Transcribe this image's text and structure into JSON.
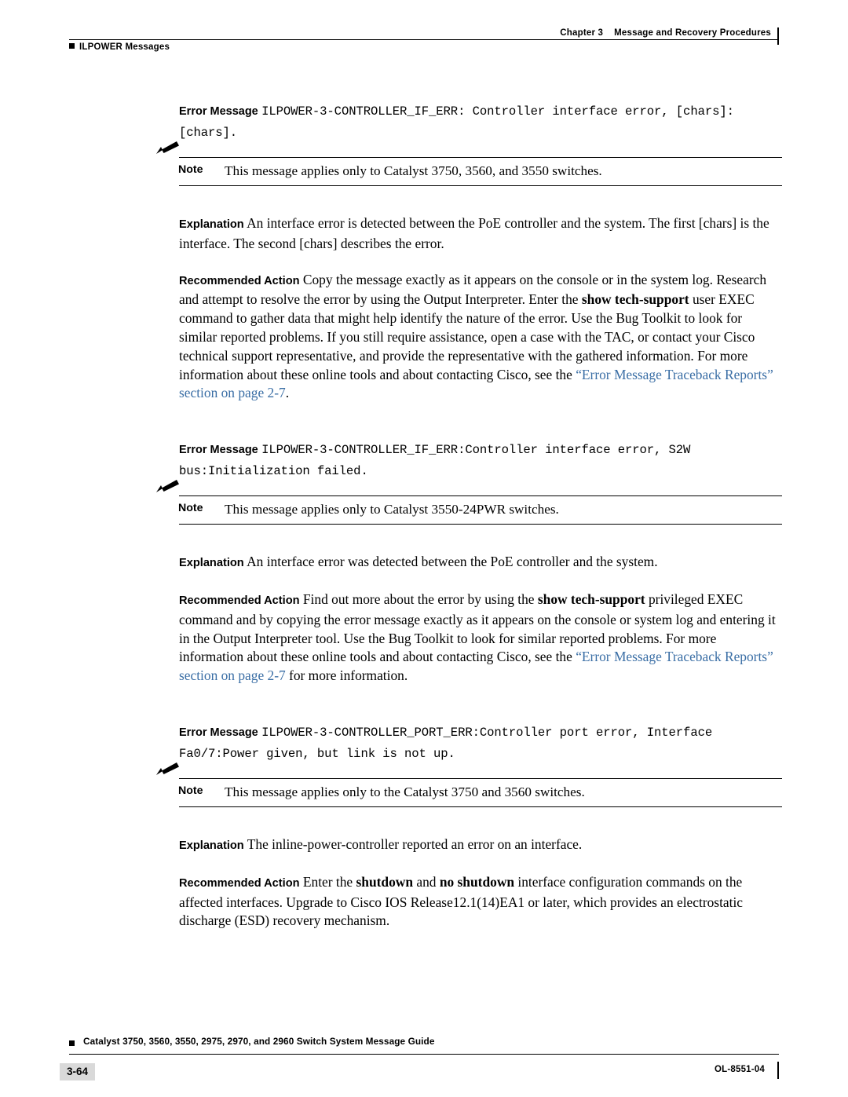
{
  "header": {
    "running_head_left": "ILPOWER Messages",
    "chapter_label": "Chapter 3",
    "chapter_title": "Message and Recovery Procedures"
  },
  "footer": {
    "book_title": "Catalyst 3750, 3560, 3550, 2975, 2970, and 2960 Switch System Message Guide",
    "page_number": "3-64",
    "doc_id": "OL-8551-04"
  },
  "entries": [
    {
      "error_message_label": "Error Message",
      "error_message_text": "ILPOWER-3-CONTROLLER_IF_ERR: Controller interface error, [chars]: [chars].",
      "note_label": "Note",
      "note_text": "This message applies only to Catalyst 3750, 3560, and 3550 switches.",
      "explanation_label": "Explanation",
      "explanation_text": "An interface error is detected between the PoE controller and the system. The first [chars] is the interface. The second [chars] describes the error.",
      "action_label": "Recommended Action",
      "action_text_1": "Copy the message exactly as it appears on the console or in the system log. Research and attempt to resolve the error by using the Output Interpreter. Enter the ",
      "action_bold_1": "show tech-support",
      "action_text_2": " user EXEC command to gather data that might help identify the nature of the error. Use the Bug Toolkit to look for similar reported problems. If you still require assistance, open a case with the TAC, or contact your Cisco technical support representative, and provide the representative with the gathered information. For more information about these online tools and about contacting Cisco, see the ",
      "action_link": "“Error Message Traceback Reports” section on page 2-7",
      "action_text_3": "."
    },
    {
      "error_message_label": "Error Message",
      "error_message_text": "ILPOWER-3-CONTROLLER_IF_ERR:Controller interface error, S2W bus:Initialization failed.",
      "note_label": "Note",
      "note_text": "This message applies only to Catalyst 3550-24PWR switches.",
      "explanation_label": "Explanation",
      "explanation_text": "An interface error was detected between the PoE controller and the system.",
      "action_label": "Recommended Action",
      "action_text_1": "Find out more about the error by using the ",
      "action_bold_1": "show tech-support",
      "action_text_2": " privileged EXEC command and by copying the error message exactly as it appears on the console or system log and entering it in the Output Interpreter tool. Use the Bug Toolkit to look for similar reported problems. For more information about these online tools and about contacting Cisco, see the ",
      "action_link": "“Error Message Traceback Reports” section on page 2-7",
      "action_text_3": " for more information."
    },
    {
      "error_message_label": "Error Message",
      "error_message_text": "ILPOWER-3-CONTROLLER_PORT_ERR:Controller port error, Interface Fa0/7:Power given, but link is not up.",
      "note_label": "Note",
      "note_text": "This message applies only to the Catalyst 3750 and 3560 switches.",
      "explanation_label": "Explanation",
      "explanation_text": "The inline-power-controller reported an error on an interface.",
      "action_label": "Recommended Action",
      "action_text_1": "Enter the ",
      "action_bold_1": "shutdown",
      "action_text_2": " and ",
      "action_bold_2": "no shutdown",
      "action_text_3": " interface configuration commands on the affected interfaces. Upgrade to Cisco IOS Release12.1(14)EA1 or later, which provides an electrostatic discharge (ESD) recovery mechanism."
    }
  ]
}
